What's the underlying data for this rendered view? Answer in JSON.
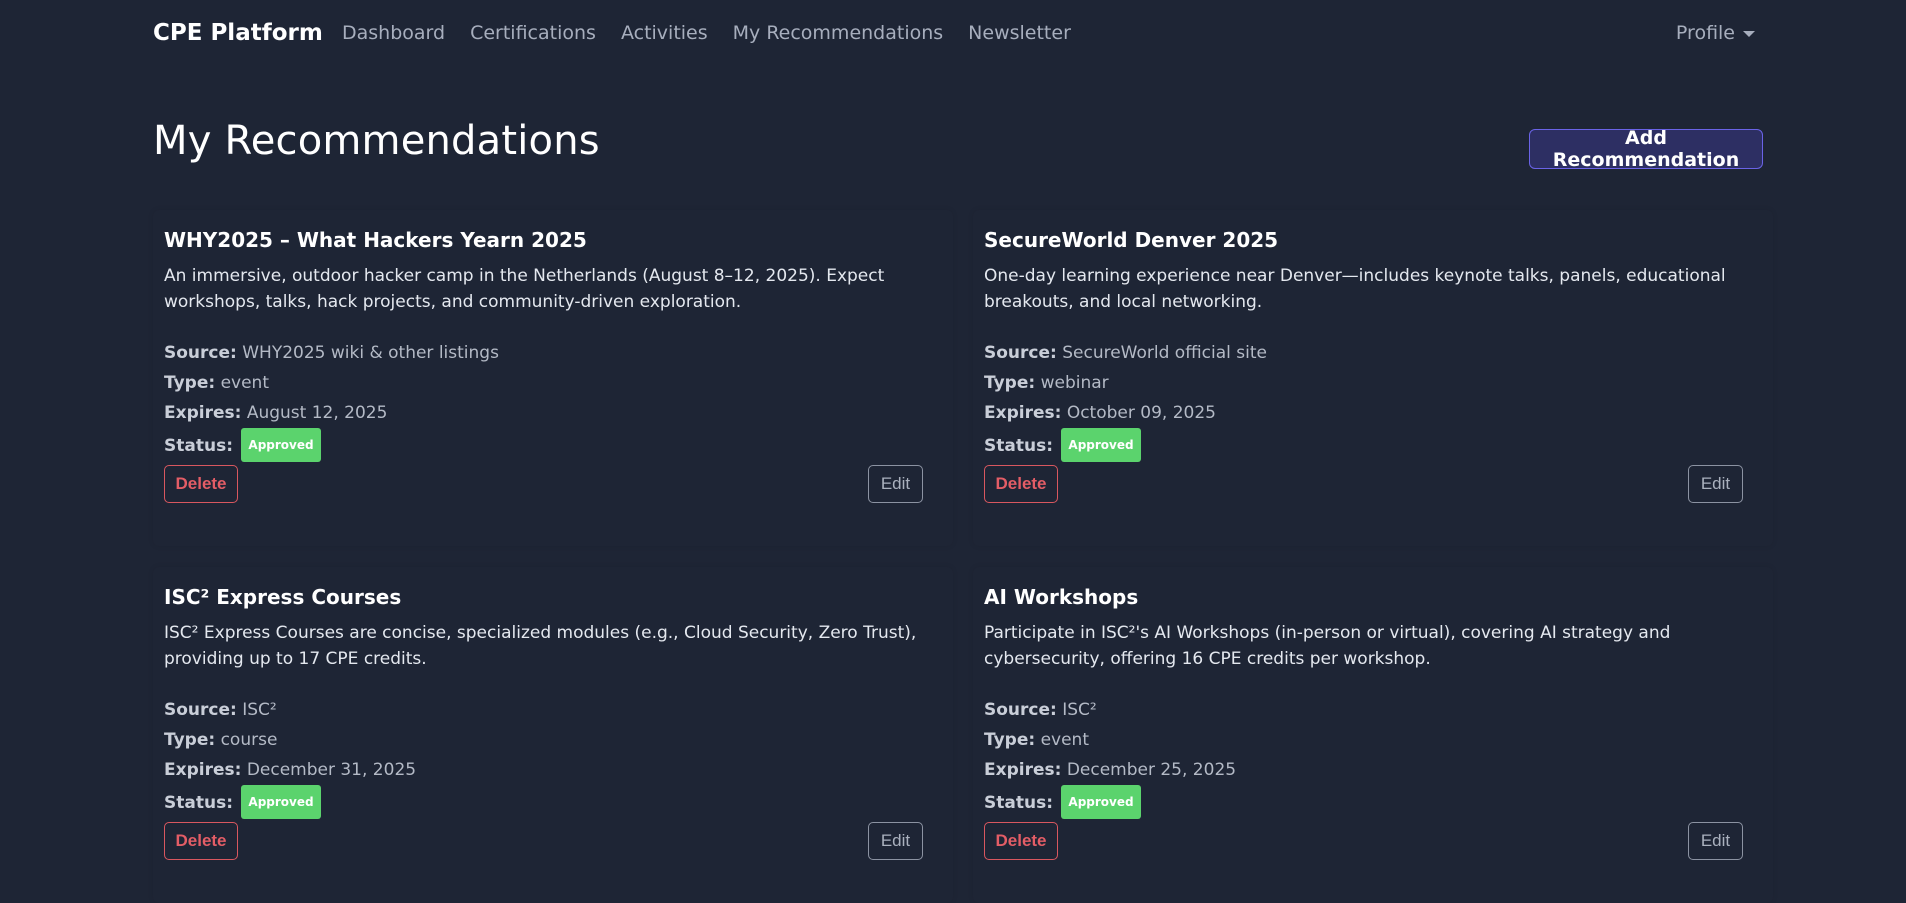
{
  "nav": {
    "brand": "CPE Platform",
    "links": [
      "Dashboard",
      "Certifications",
      "Activities",
      "My Recommendations",
      "Newsletter"
    ],
    "profile": "Profile"
  },
  "page": {
    "title": "My Recommendations",
    "add_button": "Add Recommendation"
  },
  "labels": {
    "source": "Source:",
    "type": "Type:",
    "expires": "Expires:",
    "status": "Status:",
    "delete": "Delete",
    "edit": "Edit"
  },
  "cards": [
    {
      "title": "WHY2025 – What Hackers Yearn 2025",
      "description": "An immersive, outdoor hacker camp in the Netherlands (August 8–12, 2025). Expect workshops, talks, hack projects, and community-driven exploration.",
      "source": "WHY2025 wiki & other listings",
      "type": "event",
      "expires": "August 12, 2025",
      "status": "Approved"
    },
    {
      "title": "SecureWorld Denver 2025",
      "description": "One-day learning experience near Denver—includes keynote talks, panels, educational breakouts, and local networking.",
      "source": "SecureWorld official site",
      "type": "webinar",
      "expires": "October 09, 2025",
      "status": "Approved"
    },
    {
      "title": "ISC² Express Courses",
      "description": "ISC² Express Courses are concise, specialized modules (e.g., Cloud Security, Zero Trust), providing up to 17 CPE credits.",
      "source": "ISC²",
      "type": "course",
      "expires": "December 31, 2025",
      "status": "Approved"
    },
    {
      "title": "AI Workshops",
      "description": "Participate in ISC²'s AI Workshops (in-person or virtual), covering AI strategy and cybersecurity, offering 16 CPE credits per workshop.",
      "source": "ISC²",
      "type": "event",
      "expires": "December 25, 2025",
      "status": "Approved"
    }
  ],
  "colors": {
    "background": "#1e2535",
    "accent": "#6a63e6",
    "danger": "#e35d66",
    "success": "#5bd36d"
  }
}
